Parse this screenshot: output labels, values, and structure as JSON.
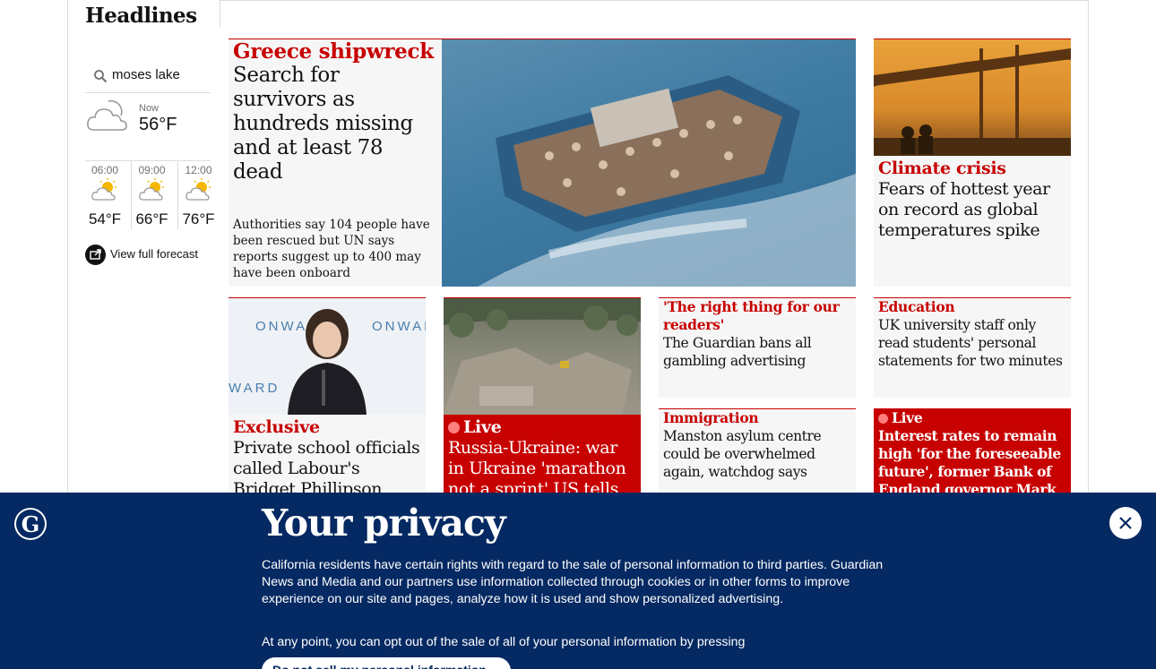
{
  "section": {
    "title": "Headlines"
  },
  "weather": {
    "location": "moses lake",
    "now_label": "Now",
    "now_temp": "56°F",
    "forecast": [
      {
        "time": "06:00",
        "temp": "54°F"
      },
      {
        "time": "09:00",
        "temp": "66°F"
      },
      {
        "time": "12:00",
        "temp": "76°F"
      }
    ],
    "view_full": "View full forecast"
  },
  "cards": {
    "greece": {
      "kicker": "Greece shipwreck",
      "headline": "Search for survivors as hundreds missing and at least 78 dead",
      "standfirst": "Authorities say 104 people have been rescued but UN says reports suggest up to 400 may have been onboard"
    },
    "climate": {
      "kicker": "Climate crisis",
      "headline": "Fears of hottest year on record as global temperatures spike"
    },
    "exclusive": {
      "kicker": "Exclusive",
      "headline": "Private school officials called Labour's Bridget Phillipson 'chippy' in"
    },
    "ukraine": {
      "kicker": "Live",
      "headline": "Russia-Ukraine: war in Ukraine 'marathon not a sprint' US tells Nato"
    },
    "gambling": {
      "kicker": "'The right thing for our readers'",
      "headline": "The Guardian bans all gambling advertising"
    },
    "education": {
      "kicker": "Education",
      "headline": "UK university staff only read students' personal statements for two minutes"
    },
    "manston": {
      "kicker": "Immigration",
      "headline": "Manston asylum centre could be overwhelmed again, watchdog says"
    },
    "rates": {
      "kicker": "Live",
      "headline": "Interest rates to remain high 'for the foreseeable future', former Bank of England governor Mark"
    }
  },
  "privacy": {
    "title": "Your privacy",
    "body": "California residents have certain rights with regard to the sale of personal information to third parties. Guardian News and Media and our partners use information collected through cookies or in other forms to improve experience on our site and pages, analyze how it is used and show personalized advertising.",
    "body2": "At any point, you can opt out of the sale of all of your personal information by pressing",
    "optout": "Do not sell my personal information"
  },
  "colors": {
    "news_red": "#c70000",
    "live_bg": "#c70000",
    "banner_blue": "#052962"
  }
}
